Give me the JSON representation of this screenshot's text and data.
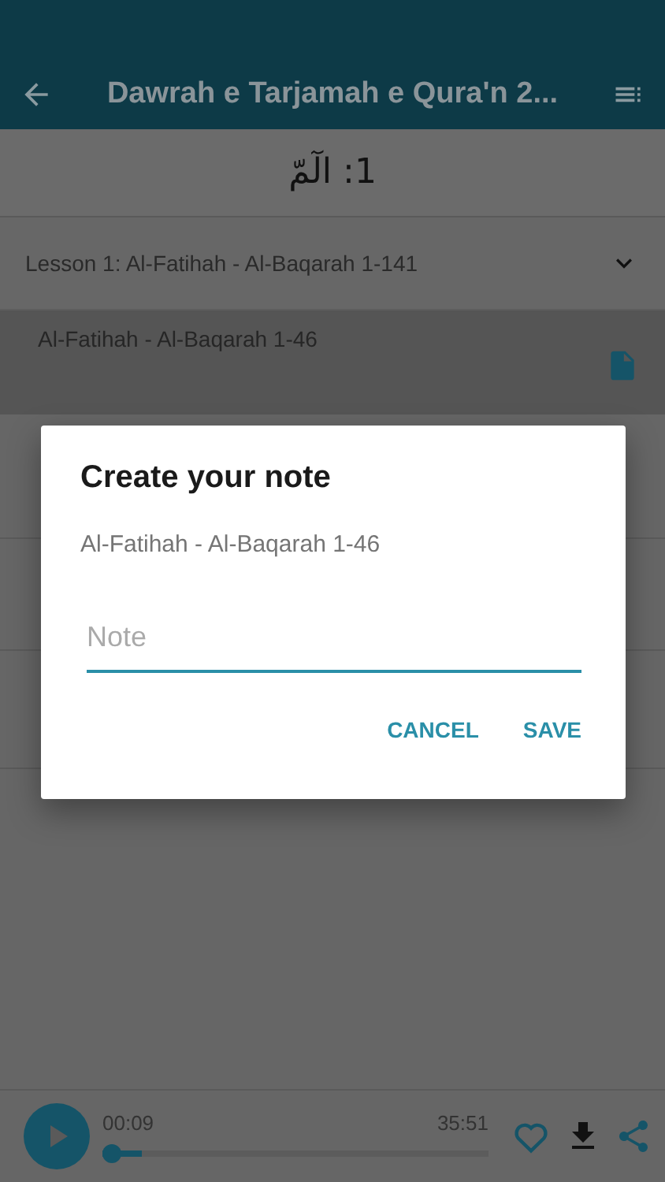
{
  "app_bar": {
    "title": "Dawrah e Tarjamah e Qura'n 2..."
  },
  "chapter_header": "1: الٓمّ",
  "lesson": {
    "title": "Lesson 1: Al-Fatihah - Al-Baqarah 1-141",
    "expanded": true
  },
  "parts": [
    {
      "title": "Al-Fatihah - Al-Baqarah 1-46",
      "selected": true,
      "has_note": true
    }
  ],
  "dialog": {
    "title": "Create your note",
    "subtitle": "Al-Fatihah - Al-Baqarah 1-46",
    "note": {
      "placeholder": "Note"
    },
    "buttons": [
      "CANCEL",
      "SAVE"
    ]
  },
  "player": {
    "elapsed": "00:09",
    "duration": "35:51",
    "level": 0.1,
    "playing": false,
    "favorite": false
  }
}
